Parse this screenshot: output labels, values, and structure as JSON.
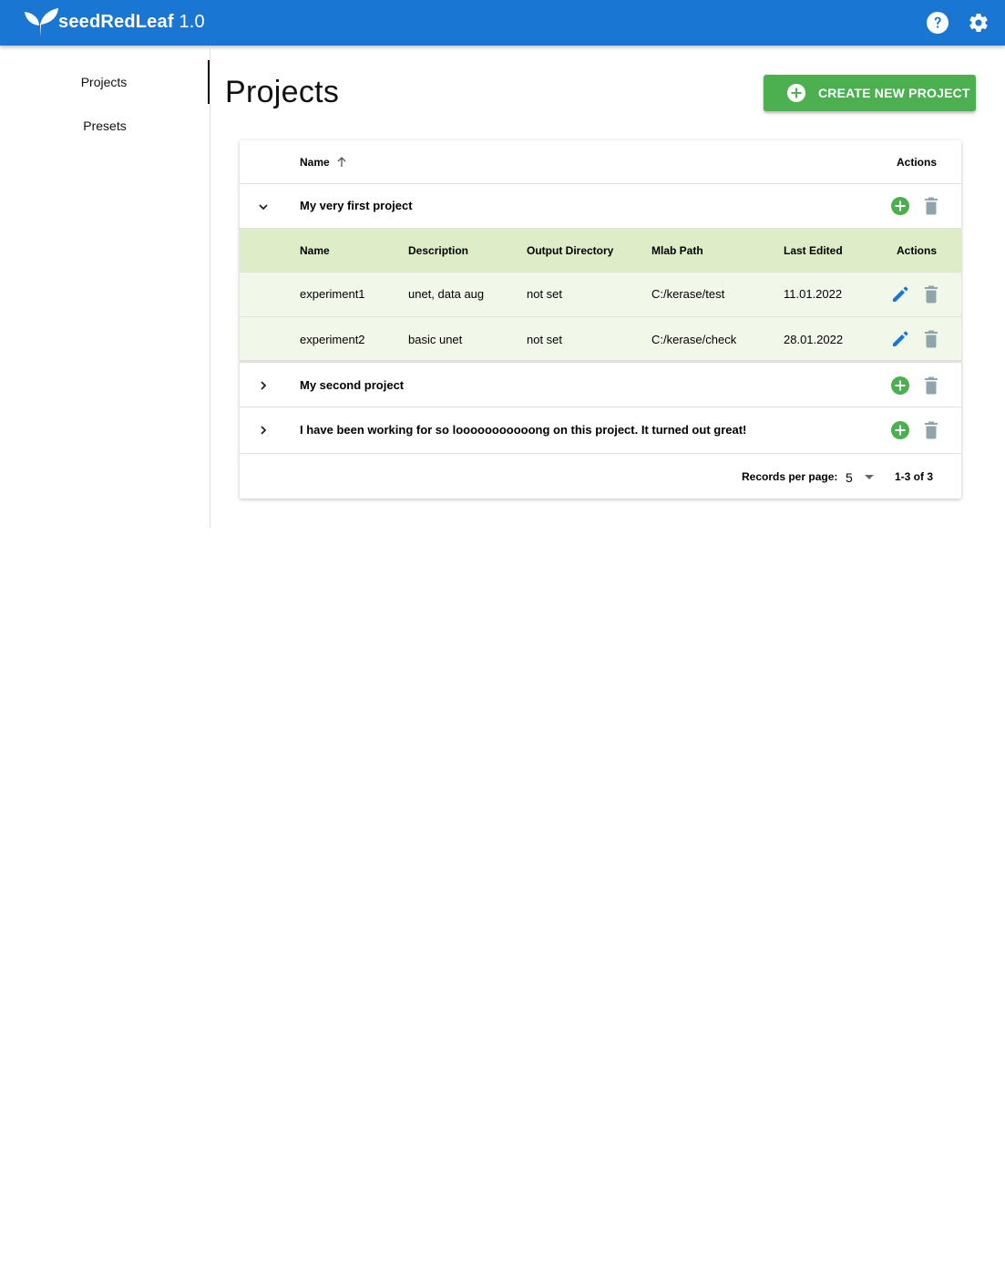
{
  "app": {
    "name": "seedRedLeaf",
    "version": "1.0"
  },
  "sidebar": {
    "items": [
      {
        "label": "Projects"
      },
      {
        "label": "Presets"
      }
    ]
  },
  "page": {
    "title": "Projects",
    "create_button": "CREATE NEW PROJECT"
  },
  "table": {
    "headers": {
      "name": "Name",
      "actions": "Actions"
    },
    "sort_icon": "arrow-up-icon",
    "projects": [
      {
        "name": "My very first project",
        "expanded": true
      },
      {
        "name": "My second project",
        "expanded": false
      },
      {
        "name": "I have been working for so looooooooooong on this project. It turned out great!",
        "expanded": false
      }
    ],
    "experiments": {
      "headers": {
        "name": "Name",
        "description": "Description",
        "output": "Output Directory",
        "mlab": "Mlab Path",
        "edited": "Last Edited",
        "actions": "Actions"
      },
      "rows": [
        {
          "name": "experiment1",
          "description": "unet, data aug",
          "output": "not set",
          "mlab": "C:/kerase/test",
          "edited": "11.01.2022"
        },
        {
          "name": "experiment2",
          "description": "basic unet",
          "output": "not set",
          "mlab": "C:/kerase/check",
          "edited": "28.01.2022"
        }
      ]
    },
    "footer": {
      "records_label": "Records per page:",
      "records_value": "5",
      "range": "1-3 of 3"
    }
  },
  "colors": {
    "primary": "#1976d2",
    "success": "#4caf50",
    "sub_header_bg": "#dcedc8",
    "sub_row_bg": "#f1f8e9",
    "delete_icon": "#90a4ae"
  }
}
